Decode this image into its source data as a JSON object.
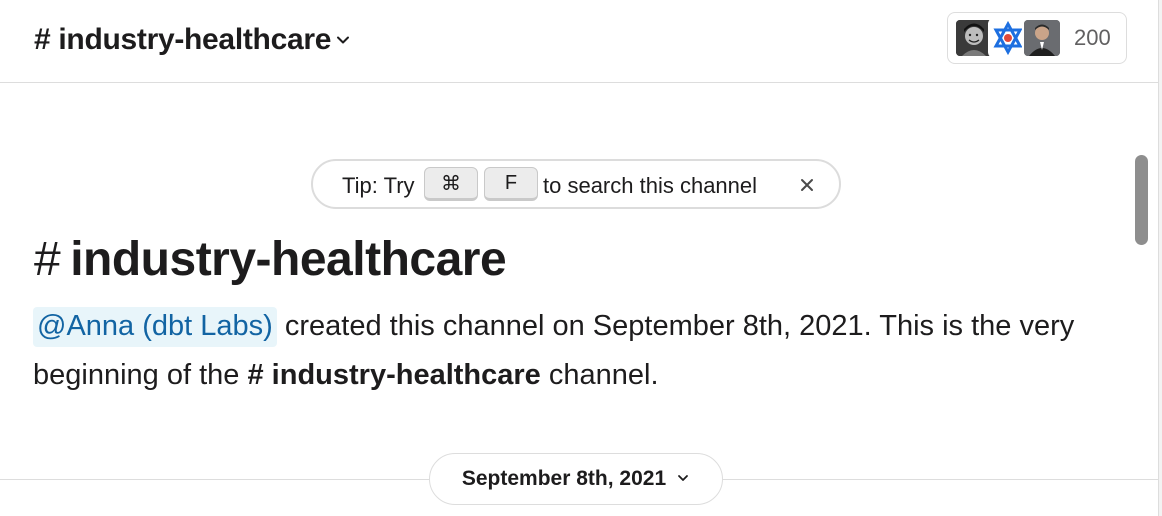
{
  "header": {
    "channel_hash": "#",
    "channel_name": "industry-healthcare",
    "member_count": "200",
    "avatars": [
      "member-avatar-1",
      "member-avatar-2",
      "member-avatar-3"
    ]
  },
  "tip": {
    "prefix": "Tip: Try",
    "key1": "⌘",
    "key2": "F",
    "suffix": "to search this channel",
    "close_icon": "close-icon"
  },
  "intro": {
    "title_hash": "#",
    "title": "industry-healthcare",
    "mention": "@Anna (dbt Labs)",
    "text_part1": " created this channel on September 8th, 2021. This is the very beginning of the ",
    "channel_ref_hash": "#",
    "channel_ref": "industry-healthcare",
    "text_part2": " channel."
  },
  "date_divider": {
    "label": "September 8th, 2021"
  },
  "colors": {
    "link": "#1264a3",
    "mention_bg": "#e8f5fa",
    "border": "#dddddd"
  }
}
